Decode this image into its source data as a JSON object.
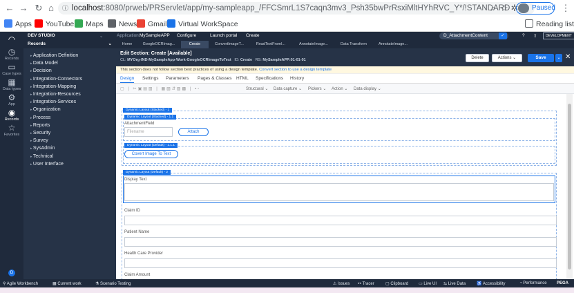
{
  "browser": {
    "url_host": "localhost",
    "url_path": ":8080/prweb/PRServlet/app/my-sampleapp_/FFCSmrL1S7caqn3mv3_Psh35bwPrRsxiMltHYhRVC_Y*/!STANDARD",
    "profile_label": "Paused",
    "bookmarks": [
      "Apps",
      "YouTube",
      "Maps",
      "News",
      "Gmail",
      "Virtual WorkSpace"
    ],
    "reading_list": "Reading list"
  },
  "rail": {
    "items": [
      {
        "label": "Recents",
        "glyph": "◷"
      },
      {
        "label": "Case types",
        "glyph": "▭"
      },
      {
        "label": "Data types",
        "glyph": "▦"
      },
      {
        "label": "App",
        "glyph": "⚙"
      },
      {
        "label": "Records",
        "glyph": "◉"
      },
      {
        "label": "Favorites",
        "glyph": "☆"
      }
    ]
  },
  "header": {
    "studio": "DEV STUDIO",
    "application_label": "Application:",
    "application": "MySampleAPP",
    "menus": [
      "Configure",
      "Launch portal",
      "Create"
    ],
    "search_value": "D_AttachmentContent",
    "env": "DEVELOPMENT"
  },
  "explorer": {
    "title": "Records",
    "items": [
      "Application Definition",
      "Data Model",
      "Decision",
      "Integration-Connectors",
      "Integration-Mapping",
      "Integration-Resources",
      "Integration-Services",
      "Organization",
      "Process",
      "Reports",
      "Security",
      "Survey",
      "SysAdmin",
      "Technical",
      "User Interface"
    ]
  },
  "tabs": [
    "Home",
    "GoogleOCRImag...",
    "Create",
    "ConvertImageT...",
    "ReadTextFromI...",
    "AnnotateImage...",
    "Data Transform",
    "AnnotateImage..."
  ],
  "rule": {
    "title": "Edit Section: Create [Available]",
    "cl_label": "CL:",
    "cl_value": "MYOrg-IND-MySampleApp-Work-GoogleOCRImageToText",
    "id_label": "ID:",
    "id_value": "Create",
    "rs_label": "RS:",
    "rs_value": "MySampleAPP:01-01-01",
    "delete": "Delete",
    "actions": "Actions",
    "save": "Save"
  },
  "warning": {
    "text": "This section does not follow section best practices of using a design template.",
    "link": "Convert section to use a design template"
  },
  "subtabs": [
    "Design",
    "Settings",
    "Parameters",
    "Pages & Classes",
    "HTML",
    "Specifications",
    "History"
  ],
  "toolbar": [
    "Structural",
    "Data capture",
    "Pickers",
    "Action",
    "Data display"
  ],
  "canvas": {
    "dl1": "Dynamic Layout (Stacked) - 1",
    "dl11": "Dynamic Layout (Stacked) - 1.1",
    "attachment_label": "AttachmentField",
    "filename_placeholder": "Filename",
    "attach": "Attach",
    "dl111": "Dynamic Layout (Default) - 1.1.1",
    "convert": "Covert Image To Text",
    "dl2": "Dynamic Layout (Default) - 2",
    "display_text": "Display Text",
    "claim_id": "Claim ID",
    "patient_name": "Patient Name",
    "provider": "Health Care Provider",
    "claim_amount": "Claim Amount"
  },
  "bottombar": {
    "left": [
      "Agile Workbench",
      "Current work",
      "Scenario Testing"
    ],
    "right": [
      "Issues",
      "Tracer",
      "Clipboard",
      "Live UI",
      "Live Data",
      "Accessibility",
      "Performance",
      "PEGA"
    ]
  },
  "colors": {
    "accent": "#1a73e8",
    "dark": "#1f2a3c",
    "explorer": "#263347"
  }
}
